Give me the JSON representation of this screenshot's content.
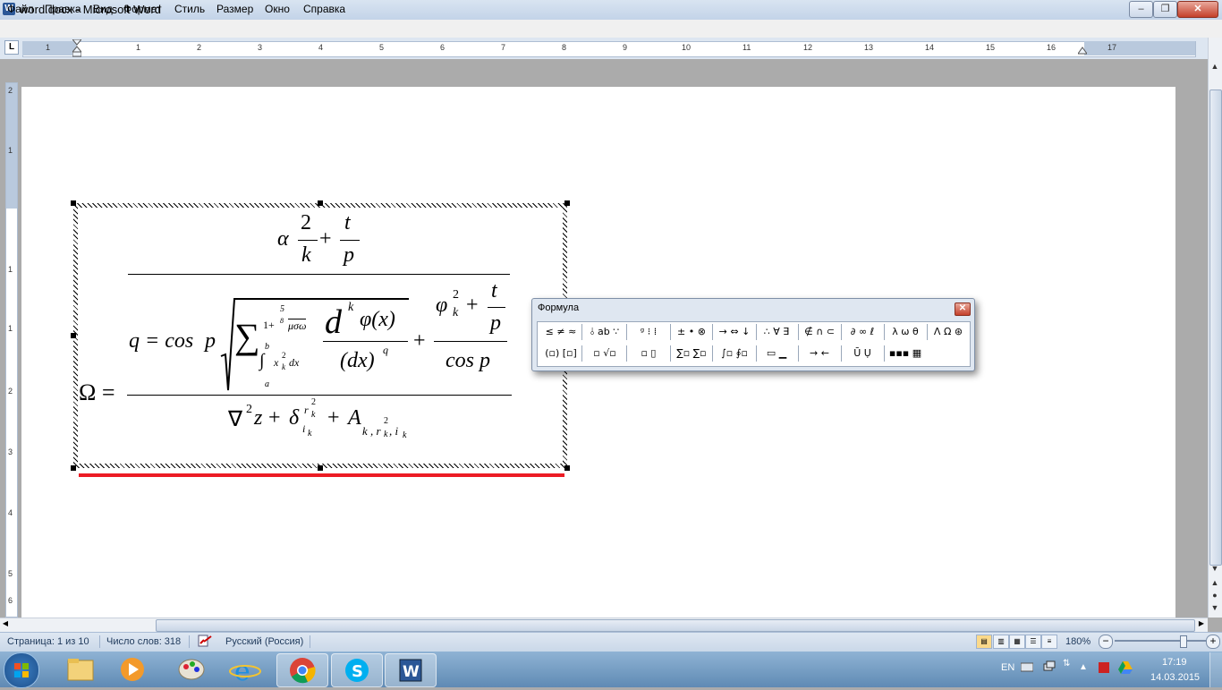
{
  "window": {
    "title": "word.docx - Microsoft Word",
    "app_icon": "W",
    "minimize": "‒",
    "maximize": "❐",
    "close": "✕"
  },
  "menu": [
    "Файл",
    "Правка",
    "Вид",
    "Формат",
    "Стиль",
    "Размер",
    "Окно",
    "Справка"
  ],
  "ruler": {
    "tab_selector": "L",
    "numbers": [
      "1",
      "1",
      "2",
      "3",
      "4",
      "5",
      "6",
      "7",
      "8",
      "9",
      "10",
      "11",
      "12",
      "13",
      "14",
      "15",
      "16",
      "17"
    ]
  },
  "vruler": {
    "numbers": [
      "2",
      "1",
      "1",
      "1",
      "2",
      "3",
      "4",
      "5",
      "6"
    ]
  },
  "formula": {
    "omega": "Ω =",
    "alpha": "α",
    "two": "2",
    "k1": "k",
    "plus": "+",
    "t": "t",
    "p1": "p",
    "q_eq": "q = cos",
    "p2": "p",
    "sum": "∑",
    "sup_expr": "1+",
    "root_index": "5",
    "root_index2": "8",
    "musigma": "μσω",
    "int_b": "b",
    "int_a": "a",
    "integral": "∫",
    "x": "x",
    "sq": "2",
    "k_sub": "k",
    "dx": "dx",
    "d": "d",
    "k_sup": "k",
    "phi_x": "φ(x)",
    "dx_den": "(dx)",
    "q_sup": "q",
    "plus2": "+",
    "phi": "φ",
    "phi_sup": "2",
    "phi_sub": "k",
    "plus3": "+",
    "t2": "t",
    "p3": "p",
    "cosp": "cos p",
    "nabla": "∇",
    "nabla_sup": "2",
    "z": "z",
    "plus4": "+",
    "delta": "δ",
    "delta_sup": "r",
    "delta_sup2": "2",
    "delta_sup_sub": "k",
    "delta_sub": "i",
    "delta_sub_sub": "k",
    "plus5": "+",
    "A": "A",
    "A_sub": "k , r",
    "A_sub_sup": "2",
    "A_sub_k": "k",
    "A_sub_i": ", i",
    "A_sub_ik": "k"
  },
  "palette": {
    "title": "Формула",
    "close": "✕",
    "row1": [
      "≤ ≠ ≈",
      "⫰ ab ∵",
      "ᵍ ⁝ ⁞",
      "± • ⊗",
      "→ ⇔ ↓",
      "∴ ∀ ∃",
      "∉ ∩ ⊂",
      "∂ ∞ ℓ",
      "λ ω θ",
      "Λ Ω ⊛"
    ],
    "row2": [
      "(▫) [▫]",
      "▫ √▫",
      "▫ ▯",
      "∑▫ ∑▫",
      "∫▫ ∮▫",
      "▭ ▁",
      "→ ←",
      "Ū Ụ",
      "▪▪▪ ▦"
    ]
  },
  "status": {
    "page": "Страница: 1 из 10",
    "words": "Число слов: 318",
    "language": "Русский (Россия)",
    "zoom": "180%",
    "zoom_minus": "−",
    "zoom_plus": "+",
    "zoom_level": 0.7
  },
  "taskbar": {
    "lang": "EN",
    "time": "17:19",
    "date": "14.03.2015",
    "apps": [
      "start-orb-icon",
      "explorer-icon",
      "media-player-icon",
      "paint-icon",
      "internet-explorer-icon",
      "chrome-icon",
      "skype-icon",
      "word-icon"
    ]
  }
}
